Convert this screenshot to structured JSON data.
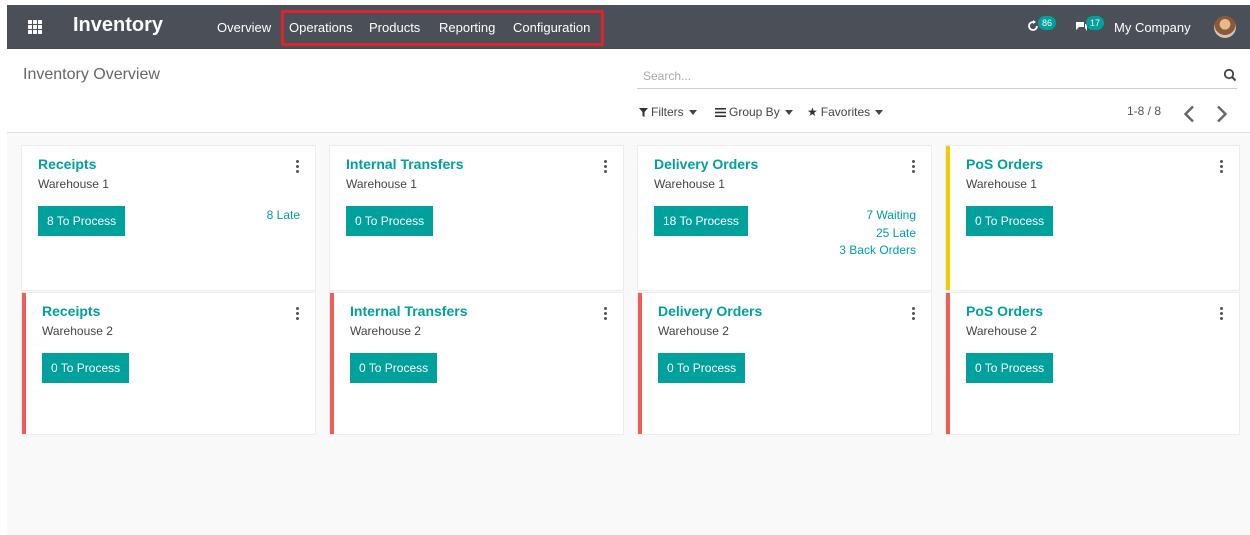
{
  "navbar": {
    "app_title": "Inventory",
    "menu": [
      "Overview",
      "Operations",
      "Products",
      "Reporting",
      "Configuration"
    ],
    "activity_count": "86",
    "message_count": "17",
    "company": "My Company"
  },
  "control_panel": {
    "title": "Inventory Overview",
    "search_placeholder": "Search...",
    "filters_label": "Filters",
    "group_by_label": "Group By",
    "favorites_label": "Favorites",
    "pager_value": "1-8 / 8"
  },
  "cards": [
    {
      "title": "Receipts",
      "warehouse": "Warehouse 1",
      "button": "8 To Process",
      "stats": [
        "8 Late"
      ],
      "border": "none"
    },
    {
      "title": "Internal Transfers",
      "warehouse": "Warehouse 1",
      "button": "0 To Process",
      "stats": [],
      "border": "none"
    },
    {
      "title": "Delivery Orders",
      "warehouse": "Warehouse 1",
      "button": "18 To Process",
      "stats": [
        "7 Waiting",
        "25 Late",
        "3 Back Orders"
      ],
      "border": "none"
    },
    {
      "title": "PoS Orders",
      "warehouse": "Warehouse 1",
      "button": "0 To Process",
      "stats": [],
      "border": "yellow"
    },
    {
      "title": "Receipts",
      "warehouse": "Warehouse 2",
      "button": "0 To Process",
      "stats": [],
      "border": "red"
    },
    {
      "title": "Internal Transfers",
      "warehouse": "Warehouse 2",
      "button": "0 To Process",
      "stats": [],
      "border": "red"
    },
    {
      "title": "Delivery Orders",
      "warehouse": "Warehouse 2",
      "button": "0 To Process",
      "stats": [],
      "border": "red"
    },
    {
      "title": "PoS Orders",
      "warehouse": "Warehouse 2",
      "button": "0 To Process",
      "stats": [],
      "border": "red"
    }
  ],
  "colors": {
    "navbar": "#4b5058",
    "accent": "#00a09d",
    "highlight_box": "#e0242c",
    "border_red": "#ef5d55",
    "border_yellow": "#f3cc00"
  },
  "icons": [
    "apps-icon",
    "activity-icon",
    "messages-icon",
    "search-icon",
    "filter-icon",
    "group-by-icon",
    "favorites-star-icon",
    "chevron-left-icon",
    "chevron-right-icon",
    "kebab-menu-icon"
  ]
}
